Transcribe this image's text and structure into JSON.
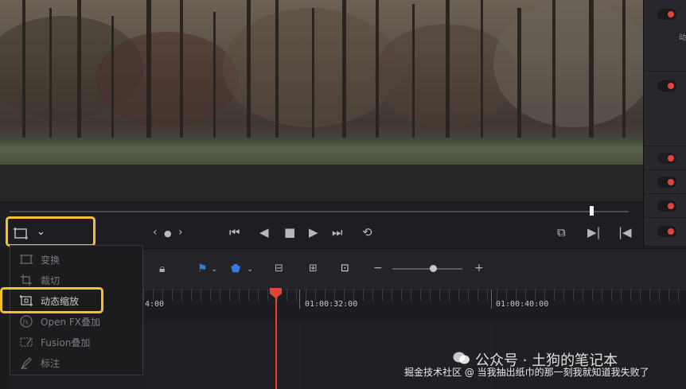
{
  "dropdown": {
    "items": [
      {
        "label": "变换",
        "icon": "transform-icon"
      },
      {
        "label": "裁切",
        "icon": "crop-icon"
      },
      {
        "label": "动态缩放",
        "icon": "dynamic-zoom-icon"
      },
      {
        "label": "Open FX叠加",
        "icon": "openfx-icon"
      },
      {
        "label": "Fusion叠加",
        "icon": "fusion-icon"
      },
      {
        "label": "标注",
        "icon": "annotation-icon"
      }
    ],
    "selected": "动态缩放"
  },
  "timeline": {
    "timecodes": [
      "4:00",
      "01:00:32:00",
      "01:00:40:00"
    ]
  },
  "watermark": {
    "line1": "公众号 · 土狗的笔记本",
    "line2": "掘金技术社区 @ 当我抽出纸巾的那一刻我就知道我失败了"
  },
  "colors": {
    "highlight": "#f6c02b",
    "playhead": "#e0453a",
    "background": "#1e1e22"
  }
}
